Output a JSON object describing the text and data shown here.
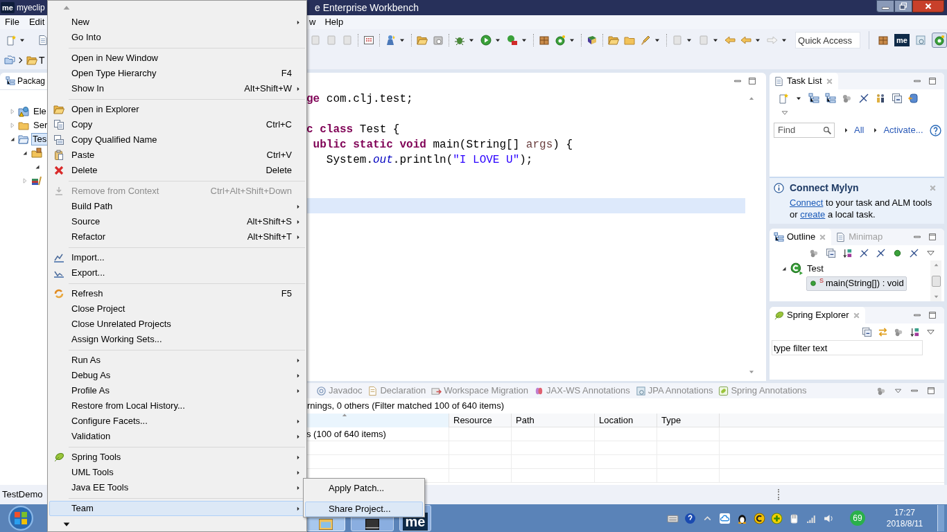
{
  "title_bar": {
    "logo": "me",
    "title": "myeclip",
    "title_rest": "e Enterprise Workbench"
  },
  "menu_bar": {
    "left": [
      "File",
      "Edit"
    ],
    "right": [
      "w",
      "Help"
    ]
  },
  "toolbar": {
    "quick_access": {
      "placeholder": "Quick Access"
    },
    "perspective_logo": "me"
  },
  "breadcrumb": {
    "label": "T"
  },
  "package_explorer": {
    "tab": "Packag",
    "tree": [
      {
        "label": "Ele",
        "expanded": false,
        "selected": false
      },
      {
        "label": "Ser",
        "expanded": false,
        "selected": false
      },
      {
        "label": "Tes",
        "expanded": true,
        "selected": true,
        "children": [
          {
            "expanded": true,
            "selected": false,
            "children": [
              {
                "expanded": true,
                "selected": false
              }
            ]
          },
          {
            "expanded": false,
            "selected": false
          }
        ]
      }
    ]
  },
  "editor": {
    "lines": [
      {
        "current": false,
        "segments": [
          {
            "text": "ge",
            "kind": "keyword"
          },
          {
            "text": " com.clj.test;",
            "kind": "plain"
          }
        ]
      },
      {
        "current": false
      },
      {
        "current": false,
        "segments": [
          {
            "text": "c class",
            "kind": "keyword"
          },
          {
            "text": " Test {",
            "kind": "plain"
          }
        ]
      },
      {
        "current": false,
        "segments": [
          {
            "text": " ublic static void",
            "kind": "keyword"
          },
          {
            "text": " main(String[] ",
            "kind": "plain"
          },
          {
            "text": "args",
            "kind": "param"
          },
          {
            "text": ") {",
            "kind": "plain"
          }
        ]
      },
      {
        "current": false,
        "segments": [
          {
            "text": "   System.",
            "kind": "plain"
          },
          {
            "text": "out",
            "kind": "field"
          },
          {
            "text": ".println(",
            "kind": "plain"
          },
          {
            "text": "\"I LOVE U\"",
            "kind": "string"
          },
          {
            "text": ");",
            "kind": "plain"
          }
        ]
      },
      {
        "current": false
      },
      {
        "current": false
      },
      {
        "current": true
      }
    ]
  },
  "task_list": {
    "tab": "Task List",
    "find": {
      "placeholder": "Find"
    },
    "links": [
      "All",
      "Activate..."
    ]
  },
  "connect_mylyn": {
    "title": "Connect Mylyn",
    "text": [
      {
        "text": "Connect",
        "link": true
      },
      {
        "text": " to your task and ALM tools or ",
        "link": false
      },
      {
        "text": "create",
        "link": true
      },
      {
        "text": " a local task.",
        "link": false
      }
    ]
  },
  "outline": {
    "tabs": [
      {
        "label": "Outline",
        "selected": true
      },
      {
        "label": "Minimap",
        "selected": false
      }
    ],
    "tree": [
      {
        "label": "Test",
        "expanded": true,
        "selected": false,
        "children": [
          {
            "label": "main(String[]) : void",
            "static_marker": "S",
            "selected": true
          }
        ]
      }
    ]
  },
  "spring_explorer": {
    "tab": "Spring Explorer",
    "filter": {
      "value": "type filter text"
    }
  },
  "bottom_panel": {
    "tabs": [
      {
        "label": "Javadoc",
        "selected": false
      },
      {
        "label": "Declaration",
        "selected": false
      },
      {
        "label": "Workspace Migration",
        "selected": false
      },
      {
        "label": "JAX-WS Annotations",
        "selected": false
      },
      {
        "label": "JPA Annotations",
        "selected": false
      },
      {
        "label": "Spring Annotations",
        "selected": false
      }
    ],
    "summary": "rnings, 0 others (Filter matched 100 of 640 items)",
    "columns": [
      {
        "sorted": true
      },
      {
        "label": "Resource",
        "sorted": false
      },
      {
        "label": "Path",
        "sorted": false
      },
      {
        "label": "Location",
        "sorted": false
      },
      {
        "label": "Type",
        "sorted": false
      }
    ],
    "rows": [
      {
        "column_1": "s (100 of 640 items)"
      }
    ]
  },
  "status_bar": {
    "text": "TestDemo"
  },
  "context_menu": {
    "groups": [
      {
        "items": [
          {
            "label": "New",
            "submenu": true,
            "disabled": false,
            "selected": false
          },
          {
            "label": "Go Into",
            "submenu": false,
            "disabled": false,
            "selected": false
          }
        ]
      },
      {
        "items": [
          {
            "label": "Open in New Window",
            "submenu": false,
            "disabled": false,
            "selected": false
          },
          {
            "label": "Open Type Hierarchy",
            "shortcut": "F4",
            "submenu": false,
            "disabled": false,
            "selected": false
          },
          {
            "label": "Show In",
            "shortcut": "Alt+Shift+W",
            "submenu": true,
            "disabled": false,
            "selected": false
          }
        ]
      },
      {
        "items": [
          {
            "label": "Open in Explorer",
            "submenu": false,
            "disabled": false,
            "selected": false
          },
          {
            "label": "Copy",
            "shortcut": "Ctrl+C",
            "submenu": false,
            "disabled": false,
            "selected": false
          },
          {
            "label": "Copy Qualified Name",
            "submenu": false,
            "disabled": false,
            "selected": false
          },
          {
            "label": "Paste",
            "shortcut": "Ctrl+V",
            "submenu": false,
            "disabled": false,
            "selected": false
          },
          {
            "label": "Delete",
            "shortcut": "Delete",
            "submenu": false,
            "disabled": false,
            "selected": false
          }
        ]
      },
      {
        "items": [
          {
            "label": "Remove from Context",
            "shortcut": "Ctrl+Alt+Shift+Down",
            "submenu": false,
            "disabled": true,
            "selected": false
          },
          {
            "label": "Build Path",
            "submenu": true,
            "disabled": false,
            "selected": false
          },
          {
            "label": "Source",
            "shortcut": "Alt+Shift+S",
            "submenu": true,
            "disabled": false,
            "selected": false
          },
          {
            "label": "Refactor",
            "shortcut": "Alt+Shift+T",
            "submenu": true,
            "disabled": false,
            "selected": false
          }
        ]
      },
      {
        "items": [
          {
            "label": "Import...",
            "submenu": false,
            "disabled": false,
            "selected": false
          },
          {
            "label": "Export...",
            "submenu": false,
            "disabled": false,
            "selected": false
          }
        ]
      },
      {
        "items": [
          {
            "label": "Refresh",
            "shortcut": "F5",
            "submenu": false,
            "disabled": false,
            "selected": false
          },
          {
            "label": "Close Project",
            "submenu": false,
            "disabled": false,
            "selected": false
          },
          {
            "label": "Close Unrelated Projects",
            "submenu": false,
            "disabled": false,
            "selected": false
          },
          {
            "label": "Assign Working Sets...",
            "submenu": false,
            "disabled": false,
            "selected": false
          }
        ]
      },
      {
        "items": [
          {
            "label": "Run As",
            "submenu": true,
            "disabled": false,
            "selected": false
          },
          {
            "label": "Debug As",
            "submenu": true,
            "disabled": false,
            "selected": false
          },
          {
            "label": "Profile As",
            "submenu": true,
            "disabled": false,
            "selected": false
          },
          {
            "label": "Restore from Local History...",
            "submenu": false,
            "disabled": false,
            "selected": false
          },
          {
            "label": "Configure Facets...",
            "submenu": true,
            "disabled": false,
            "selected": false
          },
          {
            "label": "Validation",
            "submenu": true,
            "disabled": false,
            "selected": false
          }
        ]
      },
      {
        "items": [
          {
            "label": "Spring Tools",
            "submenu": true,
            "disabled": false,
            "selected": false
          },
          {
            "label": "UML Tools",
            "submenu": true,
            "disabled": false,
            "selected": false
          },
          {
            "label": "Java EE Tools",
            "submenu": true,
            "disabled": false,
            "selected": false
          }
        ]
      },
      {
        "items": [
          {
            "label": "Team",
            "submenu": true,
            "disabled": false,
            "selected": true
          }
        ]
      }
    ]
  },
  "submenu": {
    "items": [
      {
        "label": "Apply Patch...",
        "selected": false
      },
      {
        "label": "Share Project...",
        "selected": true
      }
    ]
  },
  "taskbar": {
    "app_logo": "me",
    "badge": "69",
    "time": "17:27",
    "date": "2018/8/11"
  }
}
